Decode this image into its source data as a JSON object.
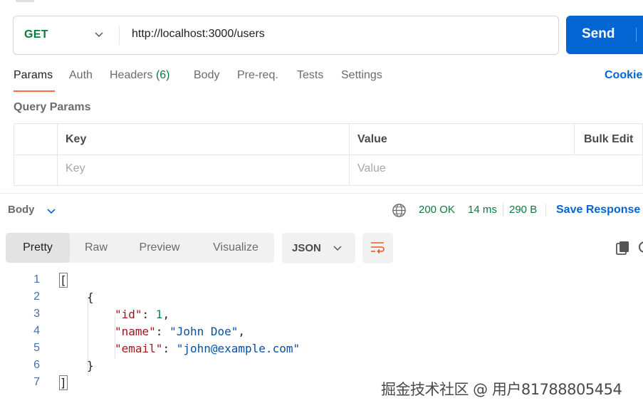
{
  "request": {
    "method": "GET",
    "url": "http://localhost:3000/users",
    "send_label": "Send"
  },
  "tabs": [
    {
      "label": "Params",
      "active": true
    },
    {
      "label": "Auth"
    },
    {
      "label": "Headers",
      "count": "(6)"
    },
    {
      "label": "Body"
    },
    {
      "label": "Pre-req."
    },
    {
      "label": "Tests"
    },
    {
      "label": "Settings"
    }
  ],
  "cookies_label": "Cookie",
  "query_params": {
    "title": "Query Params",
    "headers": {
      "key": "Key",
      "value": "Value",
      "bulk_edit": "Bulk Edit"
    },
    "placeholder": {
      "key": "Key",
      "value": "Value"
    }
  },
  "response": {
    "body_label": "Body",
    "status": "200 OK",
    "time": "14 ms",
    "size": "290 B",
    "save_label": "Save Response",
    "views": [
      "Pretty",
      "Raw",
      "Preview",
      "Visualize"
    ],
    "format": "JSON"
  },
  "code_lines": [
    {
      "num": "1",
      "text": "["
    },
    {
      "num": "2",
      "text": "{"
    },
    {
      "num": "3",
      "key": "\"id\"",
      "sep": ": ",
      "value": "1",
      "vtype": "num",
      "tail": ","
    },
    {
      "num": "4",
      "key": "\"name\"",
      "sep": ": ",
      "value": "\"John Doe\"",
      "vtype": "str",
      "tail": ","
    },
    {
      "num": "5",
      "key": "\"email\"",
      "sep": ": ",
      "value": "\"john@example.com\"",
      "vtype": "str",
      "tail": ""
    },
    {
      "num": "6",
      "text": "}"
    },
    {
      "num": "7",
      "text": "]"
    }
  ],
  "watermark": "掘金技术社区 @ 用户81788805454",
  "colors": {
    "accent": "#0265d2",
    "success": "#0c7a3e",
    "tab_indicator": "#ff6c37"
  }
}
